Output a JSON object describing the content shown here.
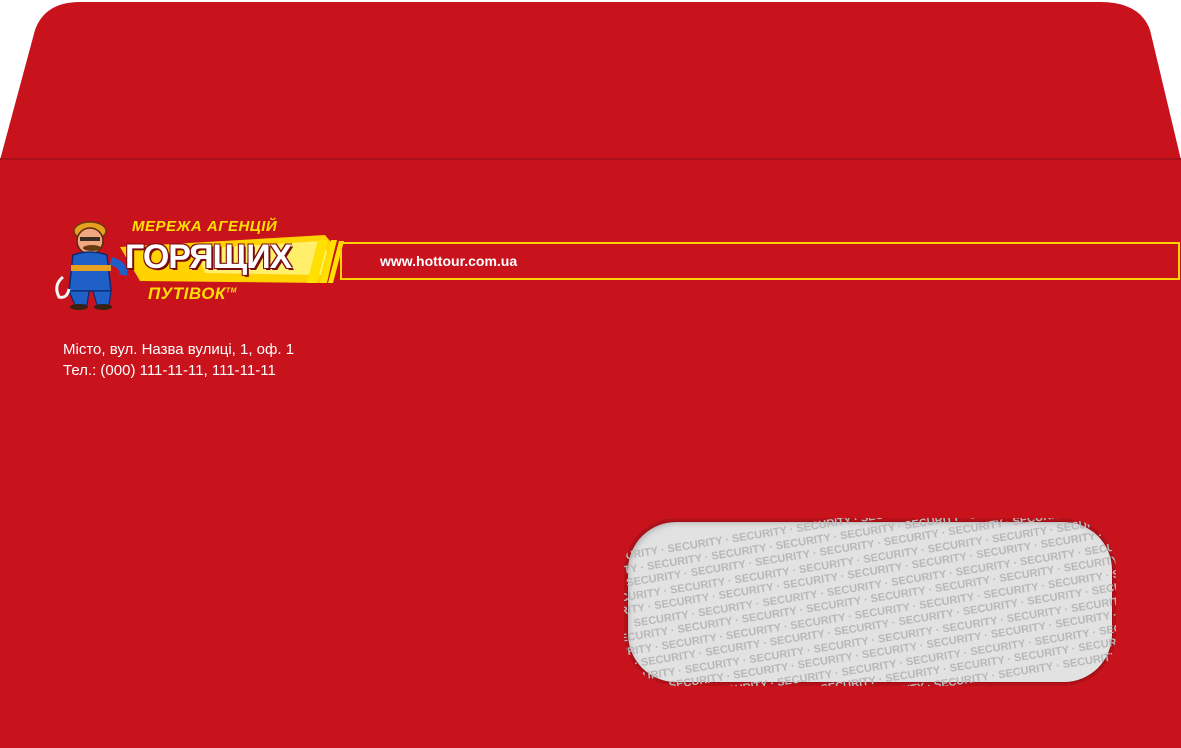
{
  "logo": {
    "line1": "МЕРЕЖА АГЕНЦІЙ",
    "line2": "ГОРЯЩИХ",
    "line3": "ПУТІВОК",
    "trademark": "TM",
    "mascot": "firefighter-mascot"
  },
  "website": "www.hottour.com.ua",
  "address": {
    "line1": "Місто, вул. Назва вулиці, 1, оф. 1",
    "line2": "Тел.: (000) 111-11-11, 111-11-11"
  },
  "window": {
    "security_text": "SECURITY"
  },
  "colors": {
    "envelope_red": "#c8121c",
    "logo_yellow": "#ffe000",
    "text_white": "#ffffff"
  }
}
